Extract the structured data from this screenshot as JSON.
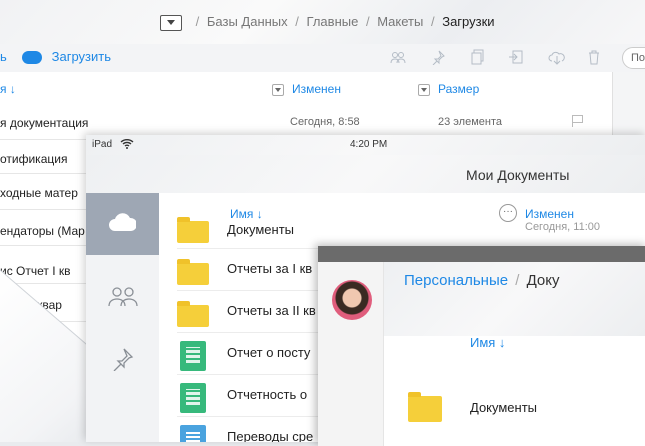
{
  "desktop": {
    "breadcrumb": [
      "Базы Данных",
      "Главные",
      "Макеты",
      "Загрузки"
    ],
    "separator": "/",
    "toolbar": {
      "left_stub": "ь",
      "upload_label": "Загрузить",
      "search_placeholder": "По"
    },
    "columns": {
      "name": "я ↓",
      "modified": "Изменен",
      "size": "Размер"
    },
    "rows": [
      {
        "name": "я документация",
        "modified": "Сегодня, 8:58",
        "size": "23 элемента"
      },
      {
        "name": "отификация"
      },
      {
        "name": "ходные матер"
      },
      {
        "name": "ендаторы (Мар"
      },
      {
        "name": "ис Отчет I кв"
      },
      {
        "name": "ет II квар"
      },
      {
        "name": ""
      }
    ]
  },
  "ipad": {
    "status": {
      "device": "iPad",
      "time": "4:20 PM"
    },
    "title": "Мои Документы",
    "columns": {
      "name": "Имя ↓",
      "modified": "Изменен",
      "modified_sub": "Сегодня, 11:00"
    },
    "rows": [
      {
        "label": "Документы",
        "icon": "folder"
      },
      {
        "label": "Отчеты за I кв",
        "icon": "folder"
      },
      {
        "label": "Отчеты за II кв",
        "icon": "folder-shared"
      },
      {
        "label": "Отчет о посту",
        "icon": "spreadsheet"
      },
      {
        "label": "Отчетность о",
        "icon": "spreadsheet"
      },
      {
        "label": "Переводы сре",
        "icon": "document"
      }
    ]
  },
  "tablet": {
    "breadcrumb_parent": "Персональные",
    "separator": "/",
    "breadcrumb_current": "Доку",
    "column": "Имя ↓",
    "rows": [
      {
        "label": "Документы",
        "icon": "folder"
      }
    ]
  },
  "colors": {
    "accent": "#1e88e5",
    "folder": "#f5cf3a",
    "sheet": "#37b97c",
    "sidebar_active": "#9ea7b4"
  }
}
